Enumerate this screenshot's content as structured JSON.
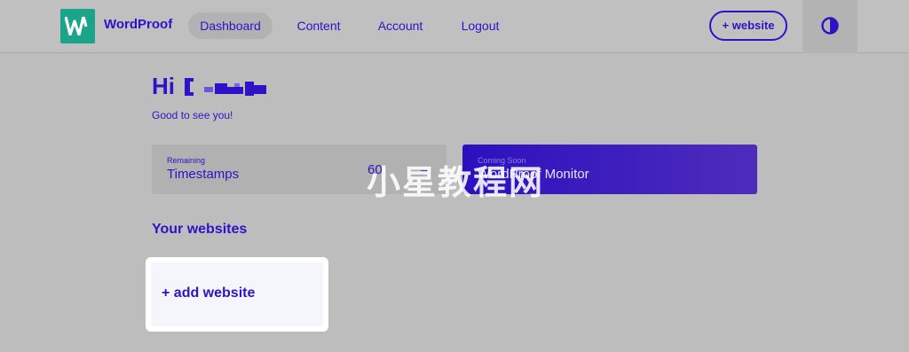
{
  "header": {
    "brand": "WordProof",
    "nav": {
      "dashboard": "Dashboard",
      "content": "Content",
      "account": "Account",
      "logout": "Logout"
    },
    "add_website": "+ website",
    "icons": {
      "logo": "wordproof-logo-icon",
      "theme_toggle": "contrast-half-circle-icon"
    }
  },
  "greeting": {
    "title": "Hi",
    "subtitle": "Good to see you!"
  },
  "cards": {
    "timestamps": {
      "small": "Remaining",
      "label": "Timestamps",
      "count": "60",
      "arrow": "→"
    },
    "monitor": {
      "small": "Coming Soon",
      "label": "WordProof Monitor"
    }
  },
  "watermark": "小星教程网",
  "websites": {
    "title": "Your websites",
    "add_label": "+ add website"
  },
  "colors": {
    "brand": "#2f12c8",
    "logo_bg": "#1aa58a",
    "background": "#bdbdbd"
  }
}
